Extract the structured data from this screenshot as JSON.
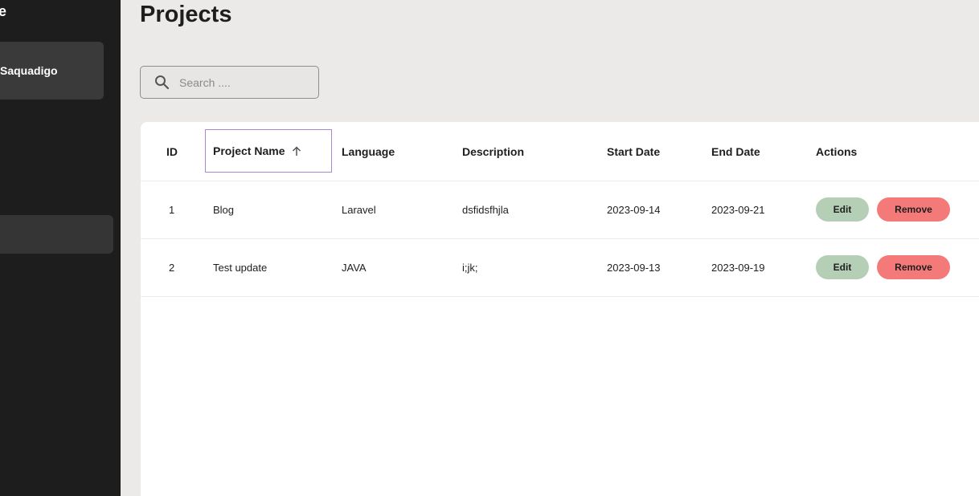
{
  "sidebar": {
    "brand_fragment": "e",
    "user_name": "Saquadigo"
  },
  "main": {
    "title": "Projects",
    "search": {
      "placeholder": "Search ...."
    }
  },
  "table": {
    "columns": [
      "ID",
      "Project Name",
      "Language",
      "Description",
      "Start Date",
      "End Date",
      "Actions"
    ],
    "sort": {
      "column": "Project Name",
      "direction": "ascending"
    },
    "rows": [
      {
        "id": "1",
        "name": "Blog",
        "language": "Laravel",
        "description": "dsfidsfhjla",
        "start": "2023-09-14",
        "end": "2023-09-21",
        "edit_label": "Edit",
        "remove_label": "Remove"
      },
      {
        "id": "2",
        "name": "Test update",
        "language": "JAVA",
        "description": "i;jk;",
        "start": "2023-09-13",
        "end": "2023-09-19",
        "edit_label": "Edit",
        "remove_label": "Remove"
      }
    ]
  },
  "colors": {
    "sidebar_bg": "#1d1d1d",
    "page_bg": "#ebeae8",
    "edit_button": "#b5cfb6",
    "remove_button": "#f47a7a",
    "sort_focus": "#a98ad0"
  },
  "icons": {
    "search": "search-icon",
    "sort": "arrow-up-icon"
  }
}
